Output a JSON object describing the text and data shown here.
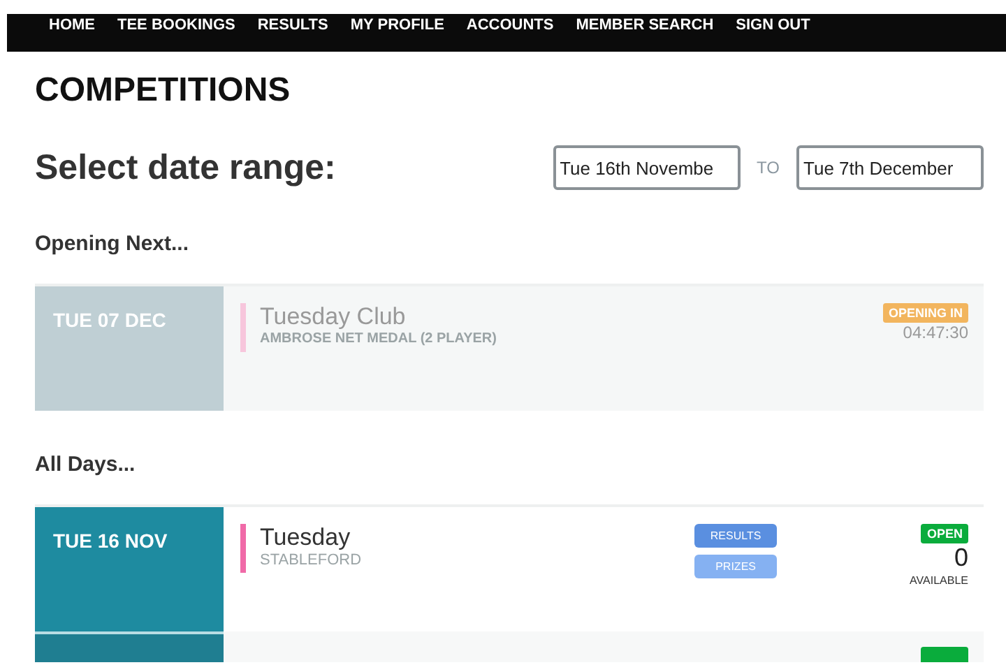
{
  "nav": {
    "items": [
      {
        "label": "HOME"
      },
      {
        "label": "TEE BOOKINGS"
      },
      {
        "label": "RESULTS"
      },
      {
        "label": "MY PROFILE"
      },
      {
        "label": "ACCOUNTS"
      },
      {
        "label": "MEMBER SEARCH"
      },
      {
        "label": "SIGN OUT"
      }
    ]
  },
  "page_title": "COMPETITIONS",
  "date_range": {
    "label": "Select date range:",
    "from": "Tue 16th Novembe",
    "separator": "TO",
    "to": "Tue 7th December"
  },
  "sections": [
    {
      "heading": "Opening Next...",
      "events": [
        {
          "kind": "upcoming",
          "date": "TUE 07 DEC",
          "title": "Tuesday Club",
          "format": "AMBROSE NET MEDAL (2 PLAYER)",
          "color": "#f7c6dc",
          "status": "OPENING IN",
          "countdown": "04:47:30"
        }
      ]
    },
    {
      "heading": "All Days...",
      "events": [
        {
          "kind": "open",
          "date": "TUE 16 NOV",
          "title": "Tuesday",
          "format": "STABLEFORD",
          "color": "#f06aa8",
          "buttons": [
            "RESULTS",
            "PRIZES"
          ],
          "status": "OPEN",
          "count": "0",
          "count_label": "AVAILABLE"
        },
        {
          "kind": "cutoff"
        }
      ]
    }
  ]
}
